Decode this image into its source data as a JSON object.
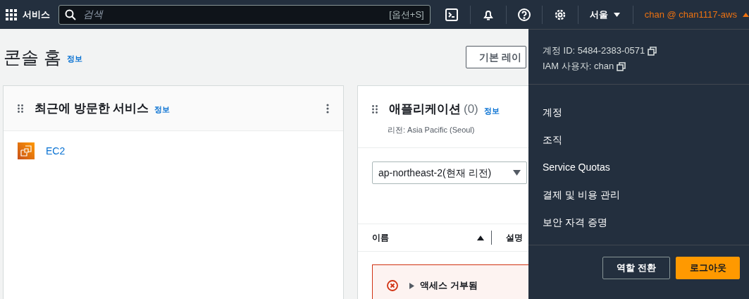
{
  "navbar": {
    "services_label": "서비스",
    "search": {
      "placeholder": "검색",
      "shortcut": "[옵션+S]"
    },
    "region": "서울",
    "account": "chan @ chan1117-aws",
    "account_expanded": true
  },
  "page": {
    "title": "콘솔 홈",
    "info_link": "정보",
    "layout_button": "기본 레이"
  },
  "widgets": [
    {
      "kind": "recent",
      "title": "최근에 방문한 서비스",
      "info_link": "정보",
      "services": [
        {
          "name": "EC2"
        }
      ]
    },
    {
      "kind": "applications",
      "title": "애플리케이션",
      "count": "(0)",
      "info_link": "정보",
      "subtitle": "리전: Asia Pacific (Seoul)",
      "region_select": "ap-northeast-2(현재 리전)",
      "columns": [
        "이름",
        "설명"
      ],
      "sort_ascending": true,
      "alert": "액세스 거부됨"
    }
  ],
  "account_menu": {
    "account_id": "계정 ID: 5484-2383-0571",
    "iam_user": "IAM 사용자: chan",
    "items": [
      "계정",
      "조직",
      "Service Quotas",
      "결제 및 비용 관리",
      "보안 자격 증명"
    ],
    "buttons": [
      {
        "label": "역할 전환",
        "kind": "secondary"
      },
      {
        "label": "로그아웃",
        "kind": "primary"
      }
    ]
  }
}
